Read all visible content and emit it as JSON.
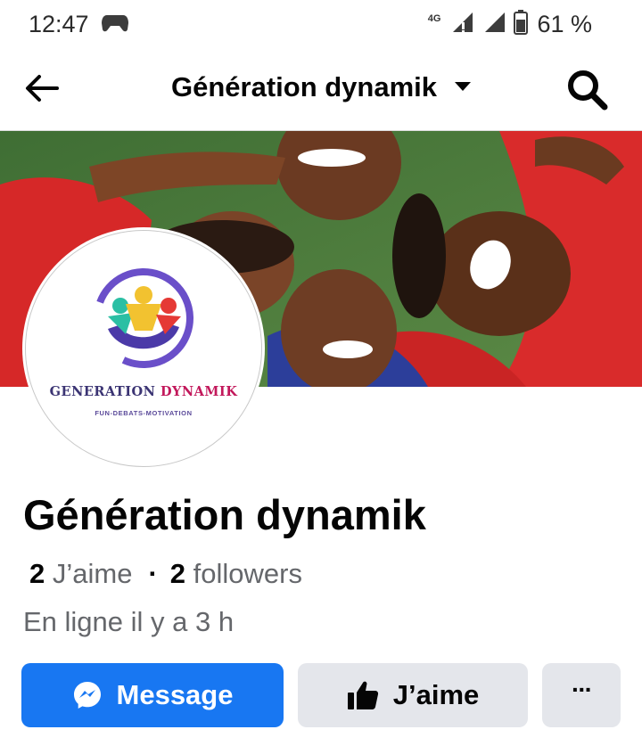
{
  "status_bar": {
    "time": "12:47",
    "network": "4G",
    "battery_percent": "61 %",
    "icons": [
      "game-controller-icon",
      "signal-icon",
      "battery-icon"
    ]
  },
  "app_bar": {
    "title": "Génération dynamik",
    "back_icon": "arrow-left-icon",
    "dropdown_icon": "caret-down-icon",
    "search_icon": "search-icon"
  },
  "avatar": {
    "brand_part1": "GENERATION",
    "brand_part2": "DYNAMIK",
    "tagline": "FUN-DEBATS-MOTIVATION",
    "colors": {
      "navy": "#3b3473",
      "pink": "#c2185b",
      "yellow": "#f2c230",
      "teal": "#2bbfa4",
      "red": "#e53935",
      "purple": "#6a4fc9"
    }
  },
  "profile": {
    "name": "Génération dynamik",
    "likes_count": "2",
    "likes_label": "J’aime",
    "separator": "·",
    "followers_count": "2",
    "followers_label": "followers",
    "online_status": "En ligne il y a 3 h"
  },
  "actions": {
    "message_label": "Message",
    "like_label": "J’aime",
    "more_label": "···",
    "message_icon": "messenger-icon",
    "like_icon": "thumbs-up-icon"
  },
  "colors": {
    "primary": "#1877f2",
    "secondary_bg": "#e4e6eb",
    "text": "#050505",
    "muted": "#65676b"
  }
}
